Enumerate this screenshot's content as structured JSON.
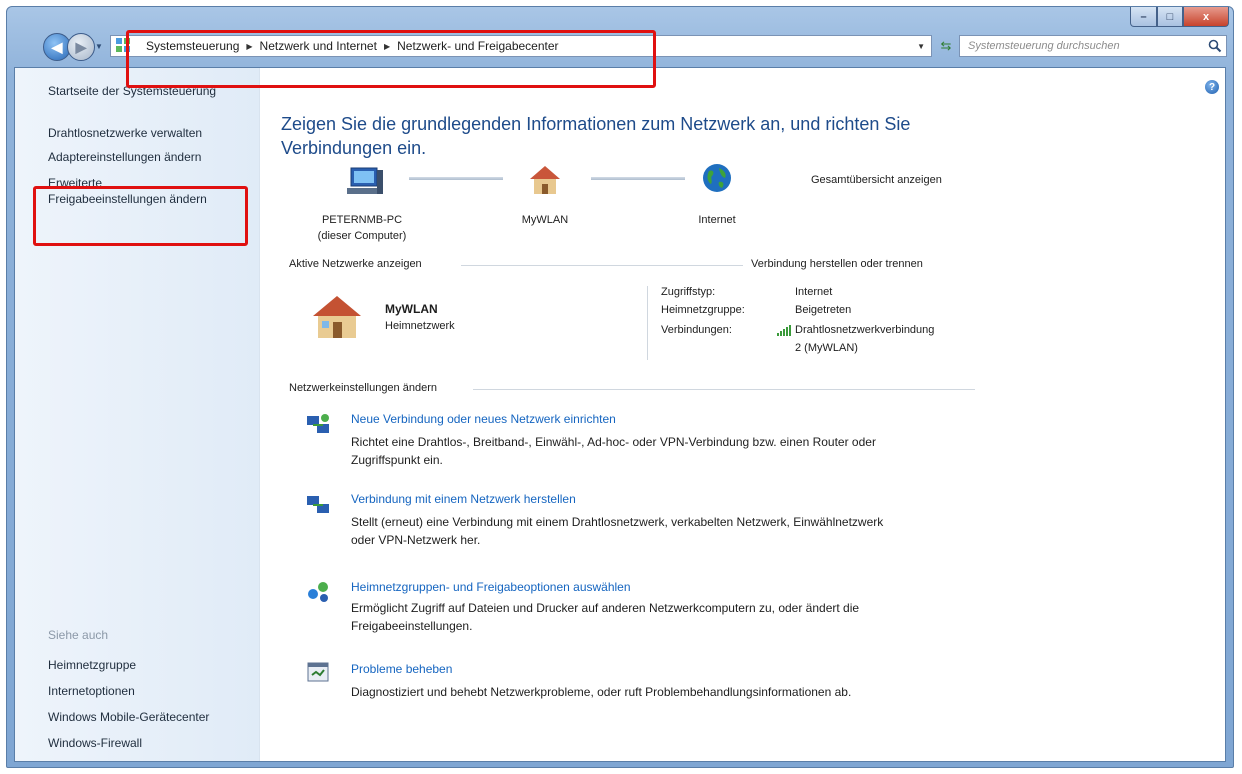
{
  "window": {
    "controls": {
      "minimize": "–",
      "maximize": "□",
      "close": "x"
    }
  },
  "navbar": {
    "breadcrumbs": [
      "Systemsteuerung",
      "Netzwerk und Internet",
      "Netzwerk- und Freigabecenter"
    ],
    "search_placeholder": "Systemsteuerung durchsuchen"
  },
  "sidebar": {
    "items": [
      "Startseite der Systemsteuerung",
      "Drahtlosnetzwerke verwalten",
      "Adaptereinstellungen ändern",
      "Erweiterte",
      "Freigabeeinstellungen ändern"
    ],
    "see_also_label": "Siehe auch",
    "see_also": [
      "Heimnetzgruppe",
      "Internetoptionen",
      "Windows Mobile-Gerätecenter",
      "Windows-Firewall"
    ]
  },
  "main": {
    "headline_line1": "Zeigen Sie die grundlegenden Informationen zum Netzwerk an, und richten Sie",
    "headline_line2": "Verbindungen ein.",
    "full_map_link": "Gesamtübersicht anzeigen",
    "map": {
      "computer_name": "PETERNMB-PC",
      "computer_sub": "(dieser Computer)",
      "network": "MyWLAN",
      "internet": "Internet"
    },
    "active_networks_label": "Aktive Netzwerke anzeigen",
    "connect_disconnect_link": "Verbindung herstellen oder trennen",
    "network_name": "MyWLAN",
    "network_type": "Heimnetzwerk",
    "details": {
      "access_label": "Zugriffstyp:",
      "access_value": "Internet",
      "homegroup_label": "Heimnetzgruppe:",
      "homegroup_value": "Beigetreten",
      "connections_label": "Verbindungen:",
      "connections_value_line1": "Drahtlosnetzwerkverbindung",
      "connections_value_line2": "2 (MyWLAN)"
    },
    "change_settings_label": "Netzwerkeinstellungen ändern",
    "tasks": [
      {
        "title": "Neue Verbindung oder neues Netzwerk einrichten",
        "desc1": "Richtet eine Drahtlos-, Breitband-, Einwähl-, Ad-hoc- oder VPN-Verbindung bzw. einen Router oder",
        "desc2": "Zugriffspunkt ein."
      },
      {
        "title": "Verbindung mit einem Netzwerk herstellen",
        "desc1": "Stellt (erneut) eine Verbindung mit einem Drahtlosnetzwerk, verkabelten Netzwerk, Einwählnetzwerk",
        "desc2": "oder VPN-Netzwerk her."
      },
      {
        "title": "Heimnetzgruppen- und Freigabeoptionen auswählen",
        "desc1": "Ermöglicht Zugriff auf Dateien und Drucker auf anderen Netzwerkcomputern zu, oder ändert die",
        "desc2": "Freigabeeinstellungen."
      },
      {
        "title": "Probleme beheben",
        "desc1": "Diagnostiziert und behebt Netzwerkprobleme, oder ruft Problembehandlungsinformationen ab.",
        "desc2": ""
      }
    ]
  },
  "colors": {
    "link": "#1565c0",
    "headline": "#1e4b8a",
    "highlight": "#e01010"
  }
}
